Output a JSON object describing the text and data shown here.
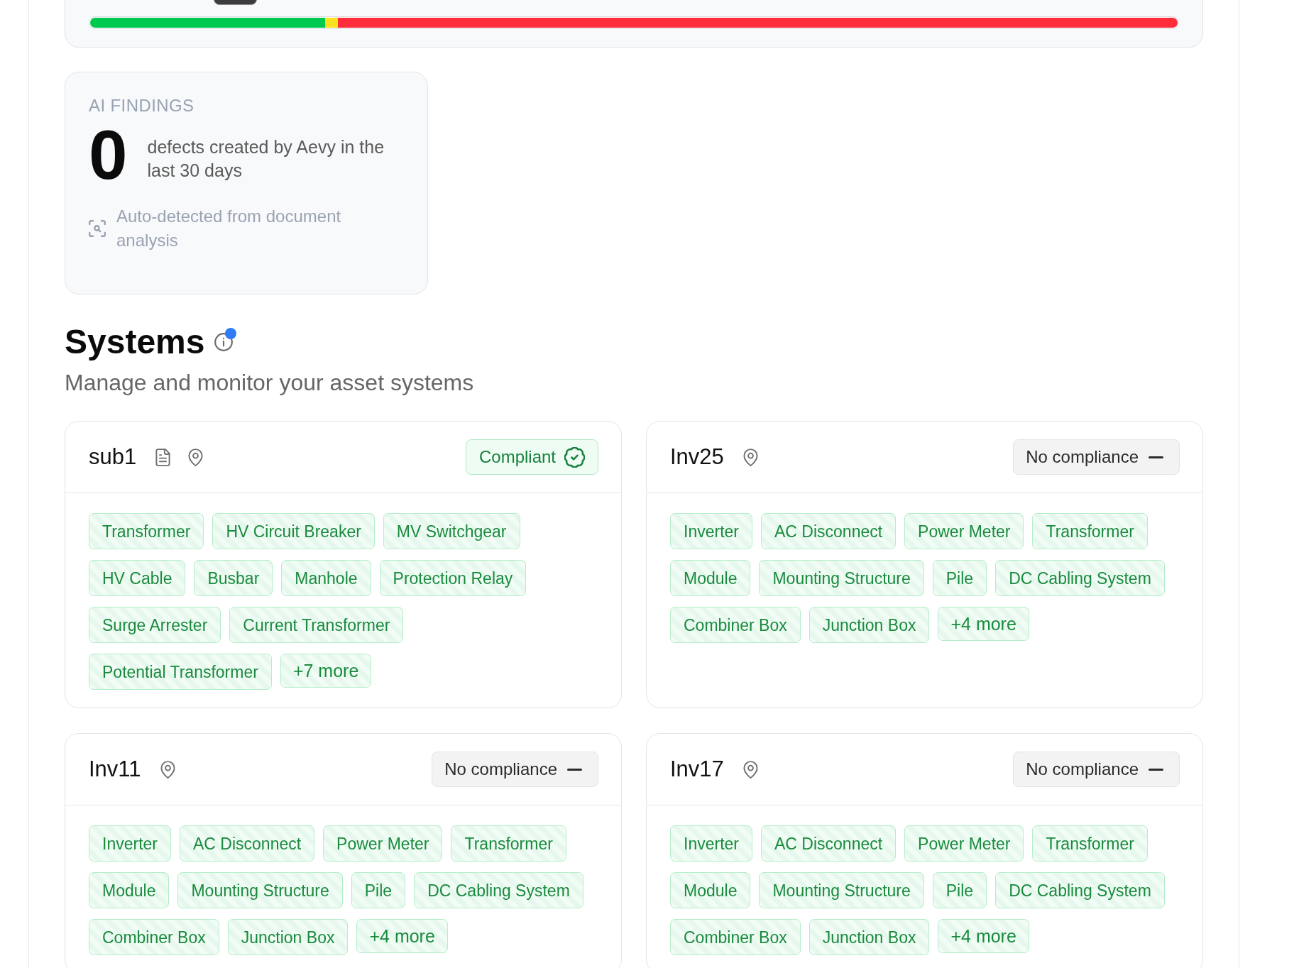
{
  "compliance_summary": {
    "segments": [
      {
        "color": "#00c950",
        "level": 0.216
      },
      {
        "color": "#fde11f",
        "level": 0.012
      },
      {
        "color": "#ff2d3c",
        "level": 0.772
      }
    ]
  },
  "ai_findings": {
    "label": "AI FINDINGS",
    "count": "0",
    "description": "defects created by Aevy in the last 30 days",
    "note": "Auto-detected from document analysis"
  },
  "systems": {
    "title": "Systems",
    "info_unread": true,
    "subtitle": "Manage and monitor your asset systems",
    "cards": [
      {
        "name": "sub1",
        "has_document": true,
        "compliance": {
          "kind": "compliant",
          "label": "Compliant"
        },
        "tags": [
          {
            "kind": "asset",
            "label": "Transformer"
          },
          {
            "kind": "asset",
            "label": "HV Circuit Breaker"
          },
          {
            "kind": "asset",
            "label": "MV Switchgear"
          },
          {
            "kind": "asset",
            "label": "HV Cable"
          },
          {
            "kind": "asset",
            "label": "Busbar"
          },
          {
            "kind": "asset",
            "label": "Manhole"
          },
          {
            "kind": "asset",
            "label": "Protection Relay"
          },
          {
            "kind": "asset",
            "label": "Surge Arrester"
          },
          {
            "kind": "asset",
            "label": "Current Transformer"
          },
          {
            "kind": "asset",
            "label": "Potential Transformer"
          },
          {
            "kind": "more",
            "label": "+7 more"
          }
        ]
      },
      {
        "name": "Inv25",
        "has_document": false,
        "compliance": {
          "kind": "none",
          "label": "No compliance"
        },
        "tags": [
          {
            "kind": "asset",
            "label": "Inverter"
          },
          {
            "kind": "asset",
            "label": "AC Disconnect"
          },
          {
            "kind": "asset",
            "label": "Power Meter"
          },
          {
            "kind": "asset",
            "label": "Transformer"
          },
          {
            "kind": "asset",
            "label": "Module"
          },
          {
            "kind": "asset",
            "label": "Mounting Structure"
          },
          {
            "kind": "asset",
            "label": "Pile"
          },
          {
            "kind": "asset",
            "label": "DC Cabling System"
          },
          {
            "kind": "asset",
            "label": "Combiner Box"
          },
          {
            "kind": "asset",
            "label": "Junction Box"
          },
          {
            "kind": "more",
            "label": "+4 more"
          }
        ]
      },
      {
        "name": "Inv11",
        "has_document": false,
        "compliance": {
          "kind": "none",
          "label": "No compliance"
        },
        "tags": [
          {
            "kind": "asset",
            "label": "Inverter"
          },
          {
            "kind": "asset",
            "label": "AC Disconnect"
          },
          {
            "kind": "asset",
            "label": "Power Meter"
          },
          {
            "kind": "asset",
            "label": "Transformer"
          },
          {
            "kind": "asset",
            "label": "Module"
          },
          {
            "kind": "asset",
            "label": "Mounting Structure"
          },
          {
            "kind": "asset",
            "label": "Pile"
          },
          {
            "kind": "asset",
            "label": "DC Cabling System"
          },
          {
            "kind": "asset",
            "label": "Combiner Box"
          },
          {
            "kind": "asset",
            "label": "Junction Box"
          },
          {
            "kind": "more",
            "label": "+4 more"
          }
        ]
      },
      {
        "name": "Inv17",
        "has_document": false,
        "compliance": {
          "kind": "none",
          "label": "No compliance"
        },
        "tags": [
          {
            "kind": "asset",
            "label": "Inverter"
          },
          {
            "kind": "asset",
            "label": "AC Disconnect"
          },
          {
            "kind": "asset",
            "label": "Power Meter"
          },
          {
            "kind": "asset",
            "label": "Transformer"
          },
          {
            "kind": "asset",
            "label": "Module"
          },
          {
            "kind": "asset",
            "label": "Mounting Structure"
          },
          {
            "kind": "asset",
            "label": "Pile"
          },
          {
            "kind": "asset",
            "label": "DC Cabling System"
          },
          {
            "kind": "asset",
            "label": "Combiner Box"
          },
          {
            "kind": "asset",
            "label": "Junction Box"
          },
          {
            "kind": "more",
            "label": "+4 more"
          }
        ]
      }
    ]
  }
}
